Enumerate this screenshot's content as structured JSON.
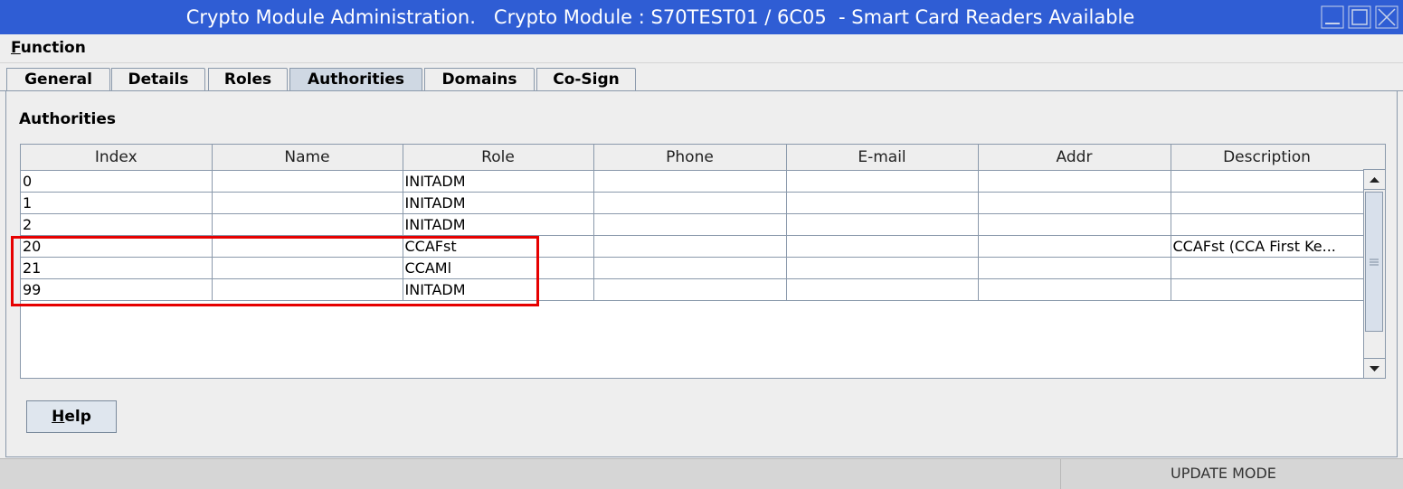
{
  "window": {
    "title": "Crypto Module Administration.   Crypto Module : S70TEST01 / 6C05  - Smart Card Readers Available"
  },
  "menu": {
    "function_mnemonic": "F",
    "function_rest": "unction"
  },
  "tabs": [
    {
      "label": "General"
    },
    {
      "label": "Details"
    },
    {
      "label": "Roles"
    },
    {
      "label": "Authorities",
      "active": true
    },
    {
      "label": "Domains"
    },
    {
      "label": "Co-Sign"
    }
  ],
  "section": {
    "title": "Authorities"
  },
  "table": {
    "columns": [
      "Index",
      "Name",
      "Role",
      "Phone",
      "E-mail",
      "Addr",
      "Description"
    ],
    "rows": [
      [
        "0",
        "",
        "INITADM",
        "",
        "",
        "",
        ""
      ],
      [
        "1",
        "",
        "INITADM",
        "",
        "",
        "",
        ""
      ],
      [
        "2",
        "",
        "INITADM",
        "",
        "",
        "",
        ""
      ],
      [
        "20",
        "",
        "CCAFst",
        "",
        "",
        "",
        "CCAFst (CCA First Ke..."
      ],
      [
        "21",
        "",
        "CCAMl",
        "",
        "",
        "",
        ""
      ],
      [
        "99",
        "",
        "INITADM",
        "",
        "",
        "",
        ""
      ]
    ]
  },
  "help_button": {
    "mnemonic": "H",
    "rest": "elp"
  },
  "status": {
    "mode": "UPDATE MODE"
  },
  "colors": {
    "titlebar": "#2f5dd4",
    "highlight": "#e60000"
  }
}
